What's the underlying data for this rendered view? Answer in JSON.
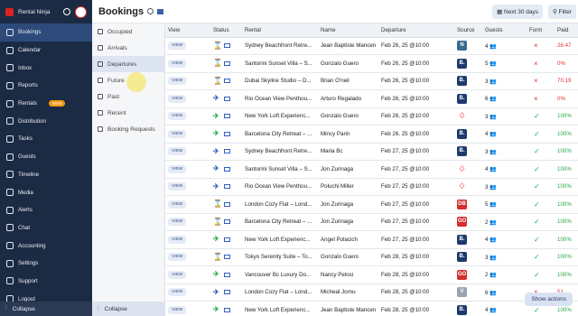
{
  "app": {
    "name": "Rental Ninja"
  },
  "sidebar": {
    "items": [
      {
        "label": "Bookings",
        "icon": "bookings-icon",
        "active": true
      },
      {
        "label": "Calendar",
        "icon": "calendar-icon"
      },
      {
        "label": "Inbox",
        "icon": "inbox-icon"
      },
      {
        "label": "Reports",
        "icon": "reports-icon"
      },
      {
        "label": "Rentals",
        "icon": "rentals-icon",
        "badge": "NEW"
      },
      {
        "label": "Distribution",
        "icon": "distribution-icon"
      },
      {
        "label": "Tasks",
        "icon": "tasks-icon"
      },
      {
        "label": "Guests",
        "icon": "guests-icon"
      },
      {
        "label": "Timeline",
        "icon": "timeline-icon"
      },
      {
        "label": "Media",
        "icon": "media-icon"
      },
      {
        "label": "Alerts",
        "icon": "alerts-icon"
      },
      {
        "label": "Chat",
        "icon": "chat-icon"
      },
      {
        "label": "Accounting",
        "icon": "accounting-icon"
      },
      {
        "label": "Settings",
        "icon": "settings-icon"
      },
      {
        "label": "Support",
        "icon": "support-icon"
      },
      {
        "label": "Logout",
        "icon": "logout-icon"
      }
    ],
    "collapse": "Collapse"
  },
  "subnav": {
    "items": [
      "Occupied",
      "Arrivals",
      "Departures",
      "Future",
      "Past",
      "Recent",
      "Booking Requests"
    ],
    "selected": "Departures",
    "collapse": "Collapse"
  },
  "page": {
    "title": "Bookings",
    "range_button": "Next 30 days",
    "filter_button": "Filter"
  },
  "table": {
    "headers": [
      "View",
      "Status",
      "Rental",
      "Name",
      "Departure",
      "Source",
      "Guests",
      "Form",
      "Paid"
    ],
    "rows": [
      {
        "view": "VIEW",
        "status": "hourglass",
        "rental": "Sydney Beachfront Retre...",
        "name": "Jean Baptiste Mancen",
        "departure": "Feb 26, 25 @10:00",
        "source": "N",
        "src_color": "#3a6a8c",
        "guests": "4",
        "form": "×",
        "paid": "26.47"
      },
      {
        "view": "VIEW",
        "status": "hourglass",
        "rental": "Santorini Sunset Villa – S...",
        "name": "Gonzalo Guero",
        "departure": "Feb 26, 25 @10:00",
        "source": "B.",
        "src_color": "#1d3a6e",
        "guests": "5",
        "form": "×",
        "paid": "0%"
      },
      {
        "view": "VIEW",
        "status": "hourglass",
        "rental": "Dubai Skyline Studio – D...",
        "name": "Brian O'neil",
        "departure": "Feb 26, 25 @10:00",
        "source": "B.",
        "src_color": "#1d3a6e",
        "guests": "3",
        "form": "×",
        "paid": "70.19"
      },
      {
        "view": "VIEW",
        "status": "depart",
        "rental": "Rio Ocean View Penthou...",
        "name": "Arturo Regalado",
        "departure": "Feb 26, 25 @10:00",
        "source": "B.",
        "src_color": "#1d3a6e",
        "guests": "6",
        "form": "×",
        "paid": "0%"
      },
      {
        "view": "VIEW",
        "status": "plane",
        "rental": "New York Loft Experienc...",
        "name": "Gonzalo Guero",
        "departure": "Feb 26, 25 @10:00",
        "source": "airbnb",
        "src_color": "#ff5a5f",
        "guests": "3",
        "form": "✓",
        "paid": "100%"
      },
      {
        "view": "VIEW",
        "status": "plane",
        "rental": "Barcelona City Retreat – ...",
        "name": "Mincy Parin",
        "departure": "Feb 26, 25 @10:00",
        "source": "B.",
        "src_color": "#1d3a6e",
        "guests": "4",
        "form": "✓",
        "paid": "100%"
      },
      {
        "view": "VIEW",
        "status": "depart",
        "rental": "Sydney Beachfront Retre...",
        "name": "Maria Bc",
        "departure": "Feb 27, 25 @10:00",
        "source": "B.",
        "src_color": "#1d3a6e",
        "guests": "3",
        "form": "✓",
        "paid": "100%"
      },
      {
        "view": "VIEW",
        "status": "depart",
        "rental": "Santorini Sunset Villa – S...",
        "name": "Jon Zurinaga",
        "departure": "Feb 27, 25 @10:00",
        "source": "airbnb",
        "src_color": "#ff5a5f",
        "guests": "4",
        "form": "✓",
        "paid": "100%"
      },
      {
        "view": "VIEW",
        "status": "depart",
        "rental": "Rio Ocean View Penthou...",
        "name": "Poluchi Miller",
        "departure": "Feb 27, 25 @10:00",
        "source": "airbnb",
        "src_color": "#ff5a5f",
        "guests": "3",
        "form": "✓",
        "paid": "100%"
      },
      {
        "view": "VIEW",
        "status": "hourglass",
        "rental": "London Cozy Flat – Lond...",
        "name": "Jon Zurinaga",
        "departure": "Feb 27, 25 @10:00",
        "source": "DB",
        "src_color": "#d32f2f",
        "guests": "5",
        "form": "✓",
        "paid": "100%"
      },
      {
        "view": "VIEW",
        "status": "hourglass",
        "rental": "Barcelona City Retreat – ...",
        "name": "Jon Zurinaga",
        "departure": "Feb 27, 25 @10:00",
        "source": "GO",
        "src_color": "#d32f2f",
        "guests": "2",
        "form": "✓",
        "paid": "100%"
      },
      {
        "view": "VIEW",
        "status": "plane",
        "rental": "New York Loft Experienc...",
        "name": "Angel Polacich",
        "departure": "Feb 27, 25 @10:00",
        "source": "B.",
        "src_color": "#1d3a6e",
        "guests": "4",
        "form": "✓",
        "paid": "100%"
      },
      {
        "view": "VIEW",
        "status": "hourglass",
        "rental": "Tokyo Serenity Suite – To...",
        "name": "Gonzalo Guero",
        "departure": "Feb 28, 25 @10:00",
        "source": "B.",
        "src_color": "#1d3a6e",
        "guests": "3",
        "form": "✓",
        "paid": "100%"
      },
      {
        "view": "VIEW",
        "status": "plane",
        "rental": "Vancouver Bc Luxury Do...",
        "name": "Nancy Pelosi",
        "departure": "Feb 28, 25 @10:00",
        "source": "GO",
        "src_color": "#d32f2f",
        "guests": "2",
        "form": "✓",
        "paid": "100%"
      },
      {
        "view": "VIEW",
        "status": "depart",
        "rental": "London Cozy Flat – Lond...",
        "name": "Micheal Jornu",
        "departure": "Feb 28, 25 @10:00",
        "source": "V",
        "src_color": "#9aa4b0",
        "guests": "6",
        "form": "×",
        "paid": "51"
      },
      {
        "view": "VIEW",
        "status": "plane",
        "rental": "New York Loft Experienc...",
        "name": "Jean Baptiste Mancen",
        "departure": "Feb 28, 25 @10:00",
        "source": "B.",
        "src_color": "#1d3a6e",
        "guests": "4",
        "form": "✓",
        "paid": "100%"
      }
    ]
  },
  "actions": {
    "show_actions": "Show actions"
  }
}
